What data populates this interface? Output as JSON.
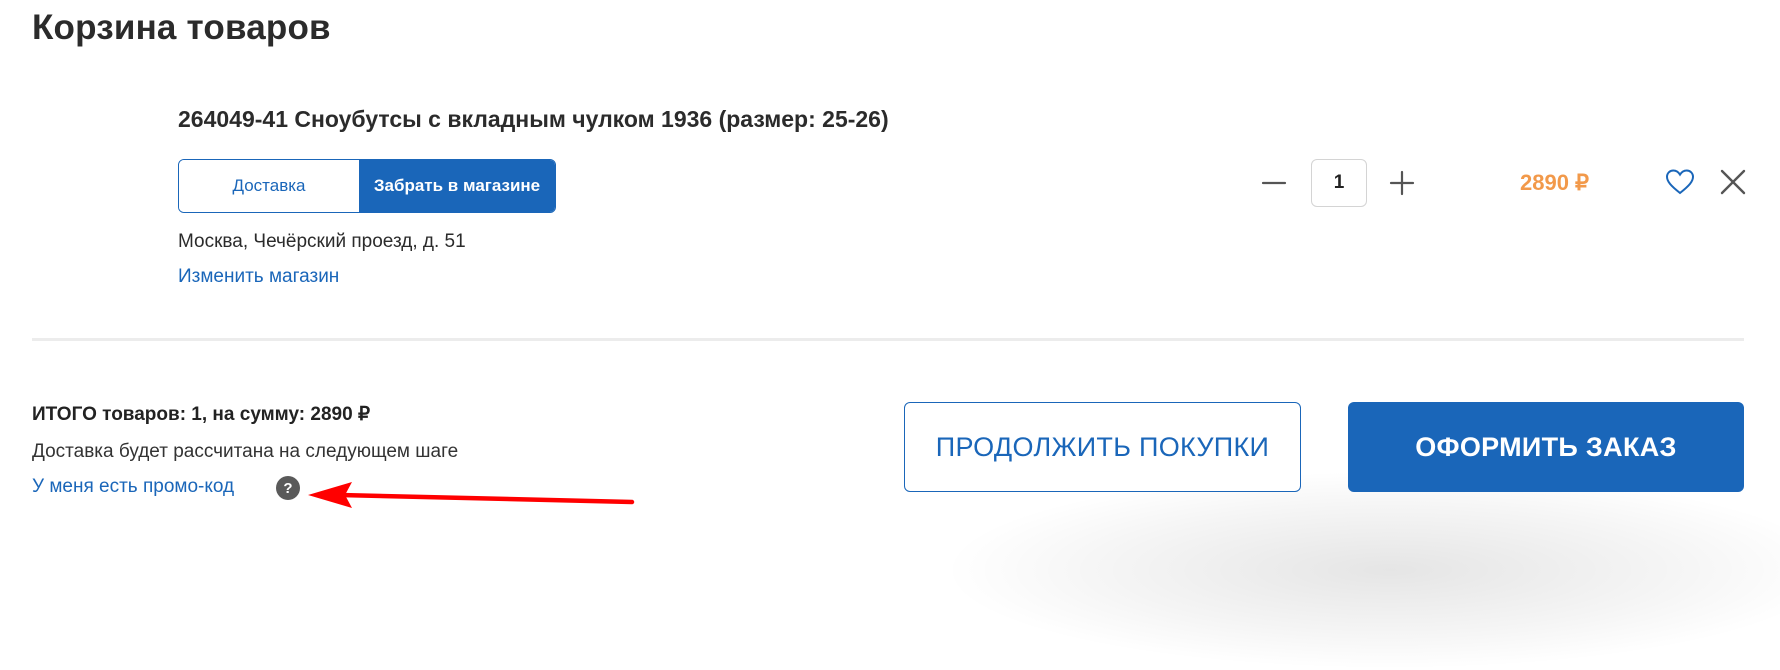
{
  "page": {
    "title": "Корзина товаров"
  },
  "cart_item": {
    "title": "264049-41 Сноубутсы с вкладным чулком 1936 (размер: 25-26)",
    "delivery_options": {
      "delivery_label": "Доставка",
      "pickup_label": "Забрать в магазине",
      "selected": "pickup"
    },
    "store_address": "Москва, Чечёрский проезд, д. 51",
    "change_store_label": "Изменить магазин",
    "quantity": "1",
    "price": "2890 ₽"
  },
  "summary": {
    "total": "ИТОГО товаров: 1, на сумму: 2890 ₽",
    "delivery_note": "Доставка будет рассчитана на следующем шаге",
    "promo_label": "У меня есть промо-код",
    "help_glyph": "?"
  },
  "actions": {
    "continue_label": "ПРОДОЛЖИТЬ ПОКУПКИ",
    "checkout_label": "ОФОРМИТЬ ЗАКАЗ"
  },
  "icons": {
    "minus": "minus-icon",
    "plus": "plus-icon",
    "favorite": "heart-icon",
    "remove": "close-icon",
    "help": "question-icon",
    "annotation": "red-arrow"
  },
  "colors": {
    "brand_blue": "#1a66b9",
    "price_orange": "#f2994a",
    "annotation_red": "#ff0000",
    "help_gray": "#5a5a5a"
  }
}
